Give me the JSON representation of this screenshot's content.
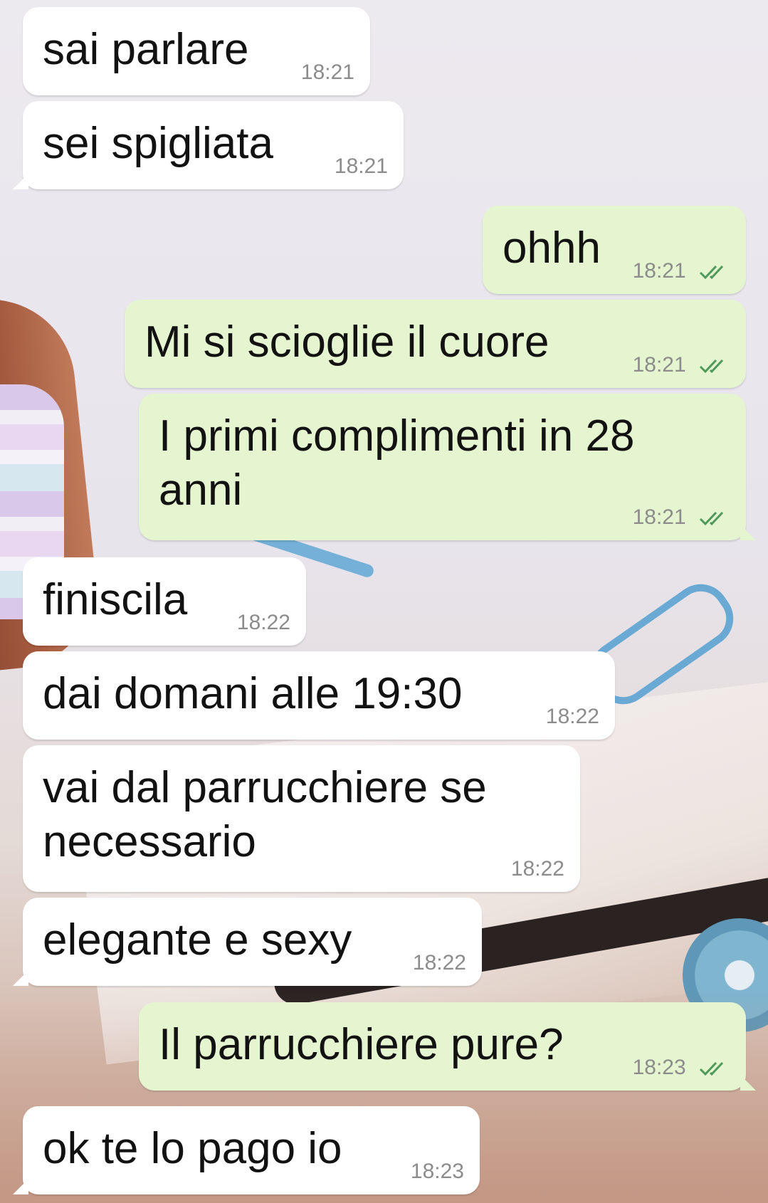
{
  "colors": {
    "incoming_bubble": "#ffffff",
    "outgoing_bubble": "#e5f5d0",
    "timestamp": "#8c8c8c",
    "read_ticks": "#4f9a5a"
  },
  "messages": [
    {
      "direction": "in",
      "text": "sai parlare",
      "time": "18:21"
    },
    {
      "direction": "in",
      "text": "sei spigliata",
      "time": "18:21"
    },
    {
      "direction": "out",
      "text": "ohhh",
      "time": "18:21",
      "status_icon": "double-check-icon"
    },
    {
      "direction": "out",
      "text": "Mi si scioglie il cuore",
      "time": "18:21",
      "status_icon": "double-check-icon"
    },
    {
      "direction": "out",
      "text": "I primi complimenti in 28 anni",
      "time": "18:21",
      "status_icon": "double-check-icon"
    },
    {
      "direction": "in",
      "text": "finiscila",
      "time": "18:22"
    },
    {
      "direction": "in",
      "text": "dai domani alle 19:30",
      "time": "18:22"
    },
    {
      "direction": "in",
      "text": "vai dal parrucchiere se necessario",
      "time": "18:22"
    },
    {
      "direction": "in",
      "text": "elegante e sexy",
      "time": "18:22"
    },
    {
      "direction": "out",
      "text": "Il parrucchiere pure?",
      "time": "18:23",
      "status_icon": "double-check-icon"
    },
    {
      "direction": "in",
      "text": "ok te lo pago io",
      "time": "18:23"
    }
  ]
}
